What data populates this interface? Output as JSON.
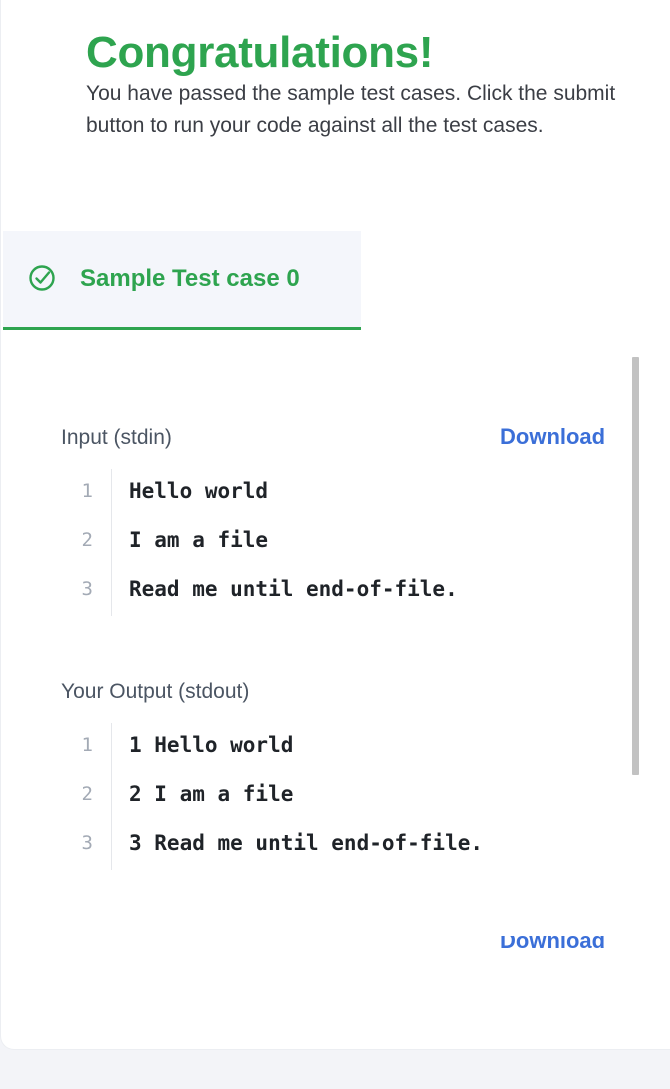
{
  "header": {
    "title": "Congratulations!",
    "description": "You have passed the sample test cases. Click the submit button to run your code against all the test cases."
  },
  "tab": {
    "label": "Sample Test case 0",
    "icon": "check-circle-icon",
    "status_color": "#2ea44f"
  },
  "input": {
    "label": "Input (stdin)",
    "download_label": "Download",
    "lines": [
      {
        "num": "1",
        "text": "Hello world"
      },
      {
        "num": "2",
        "text": "I am a file"
      },
      {
        "num": "3",
        "text": "Read me until end-of-file."
      }
    ]
  },
  "output": {
    "label": "Your Output (stdout)",
    "lines": [
      {
        "num": "1",
        "text": "1 Hello world"
      },
      {
        "num": "2",
        "text": "2 I am a file"
      },
      {
        "num": "3",
        "text": "3 Read me until end-of-file."
      }
    ]
  },
  "colors": {
    "accent_green": "#2ea44f",
    "link_blue": "#3b6fd8"
  }
}
